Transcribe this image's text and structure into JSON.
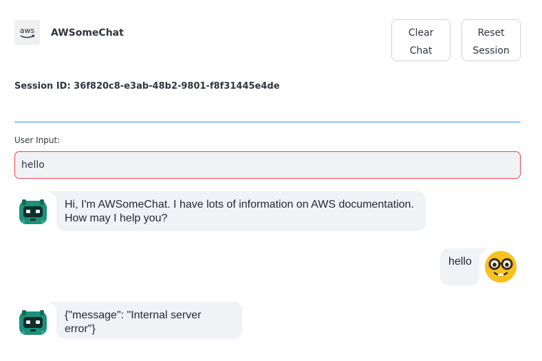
{
  "header": {
    "logo_text": "aws",
    "app_title": "AWSomeChat",
    "clear_button": "Clear\nChat",
    "reset_button": "Reset\nSession"
  },
  "session": {
    "text": "Session ID: 36f820c8-e3ab-48b2-9801-f8f31445e4de"
  },
  "input": {
    "label": "User Input:",
    "value": "hello"
  },
  "messages": [
    {
      "role": "bot",
      "text": "Hi, I'm AWSomeChat. I have lots of information on AWS documentation. How may I help you?"
    },
    {
      "role": "user",
      "text": "hello"
    },
    {
      "role": "bot",
      "text": "{\"message\": \"Internal server error\"}"
    }
  ],
  "colors": {
    "input_border": "#e8464d",
    "divider": "#a8d4f5",
    "bubble_bg": "#f0f2f6",
    "bot_avatar": "#1f8f7a",
    "user_avatar": "#f7c21f"
  },
  "icons": {
    "logo": "aws-logo-icon",
    "bot_avatar": "robot-avatar-icon",
    "user_avatar": "nerd-face-avatar-icon"
  }
}
